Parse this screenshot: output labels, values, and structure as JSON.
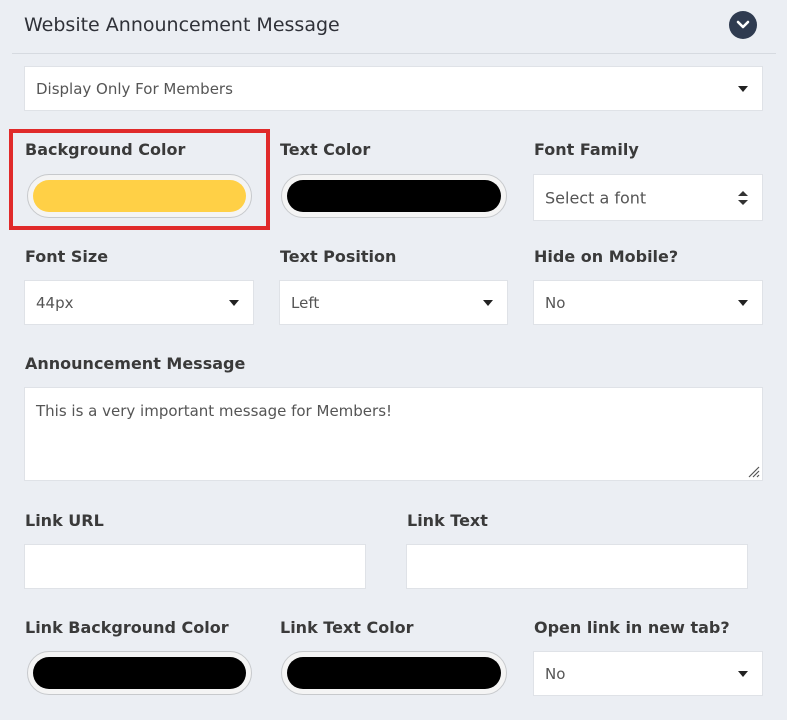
{
  "header": {
    "title": "Website Announcement Message"
  },
  "display_select": {
    "value": "Display Only For Members"
  },
  "fields": {
    "background_color": {
      "label": "Background Color",
      "color": "#ffd046"
    },
    "text_color": {
      "label": "Text Color",
      "color": "#000000"
    },
    "font_family": {
      "label": "Font Family",
      "value": "Select a font"
    },
    "font_size": {
      "label": "Font Size",
      "value": "44px"
    },
    "text_position": {
      "label": "Text Position",
      "value": "Left"
    },
    "hide_on_mobile": {
      "label": "Hide on Mobile?",
      "value": "No"
    },
    "announcement_message": {
      "label": "Announcement Message",
      "value": "This is a very important message for Members!"
    },
    "link_url": {
      "label": "Link URL",
      "value": ""
    },
    "link_text": {
      "label": "Link Text",
      "value": ""
    },
    "link_background_color": {
      "label": "Link Background Color",
      "color": "#000000"
    },
    "link_text_color": {
      "label": "Link Text Color",
      "color": "#000000"
    },
    "open_link_new_tab": {
      "label": "Open link in new tab?",
      "value": "No"
    }
  },
  "colors": {
    "highlight": "#e02a2a",
    "page_bg": "#ebeef3",
    "header_button": "#2f3b50"
  }
}
